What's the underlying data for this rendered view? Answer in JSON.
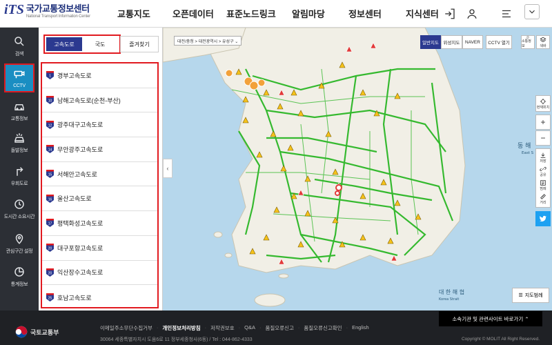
{
  "header": {
    "logo_mark": "iTS",
    "logo_title": "국가교통정보센터",
    "logo_sub": "National Transport Information Center",
    "nav": [
      "교통지도",
      "오픈데이터",
      "표준노드링크",
      "알림마당",
      "정보센터",
      "지식센터"
    ],
    "icons": [
      "login-icon",
      "user-icon",
      "menu-icon",
      "chevron-down-icon"
    ]
  },
  "sidebar": {
    "items": [
      {
        "label": "검색",
        "icon": "search-icon"
      },
      {
        "label": "CCTV",
        "icon": "cctv-icon",
        "active": true
      },
      {
        "label": "교통정보",
        "icon": "car-icon"
      },
      {
        "label": "돌발정보",
        "icon": "accident-icon"
      },
      {
        "label": "우회도로",
        "icon": "detour-icon"
      },
      {
        "label": "도시간 소요시간",
        "icon": "clock-icon"
      },
      {
        "label": "관심구간 설정",
        "icon": "pin-icon"
      },
      {
        "label": "통계정보",
        "icon": "chart-icon"
      }
    ]
  },
  "panel": {
    "tabs": [
      "고속도로",
      "국도"
    ],
    "active_tab": "고속도로",
    "favorite_label": "즐겨찾기",
    "roads": [
      {
        "num": "1",
        "name": "경부고속도로"
      },
      {
        "num": "10",
        "name": "남해고속도로(순천-부산)"
      },
      {
        "num": "12",
        "name": "광주대구고속도로"
      },
      {
        "num": "14",
        "name": "무안광주고속도로"
      },
      {
        "num": "15",
        "name": "서해안고속도로"
      },
      {
        "num": "16",
        "name": "울산고속도로"
      },
      {
        "num": "17",
        "name": "평택화성고속도로"
      },
      {
        "num": "20",
        "name": "대구포항고속도로"
      },
      {
        "num": "20",
        "name": "익산장수고속도로"
      },
      {
        "num": "25",
        "name": "호남고속도로"
      }
    ]
  },
  "map": {
    "breadcrumb": "대전/충청 > 대전광역시 > 유성구 ⌄",
    "map_types": [
      "일반지도",
      "위성지도",
      "NAVER",
      "CCTV 열기"
    ],
    "active_map_type": "일반지도",
    "controls": [
      "소통정보",
      "색바",
      "현재위치",
      "확대",
      "축소",
      "저장",
      "공유",
      "범례",
      "거리"
    ],
    "sea_east": "동 해",
    "sea_east_en": "East S",
    "sea_south": "대 한 해 협",
    "sea_south_en": "Korea Strait",
    "legend_button": "지도범례",
    "water_color": "#b6d7ec",
    "land_color": "#f1efe6",
    "road_color": "#35b92f"
  },
  "footer": {
    "ministry": "국토교통부",
    "links": [
      "이메일주소무단수집거부",
      "개인정보처리방침",
      "저작권보호",
      "Q&A",
      "품질오류신고",
      "품질오류신고확인",
      "English"
    ],
    "bold_link": "개인정보처리방침",
    "address": "30064 세종특별자치시 도움6로 11 정부세종청사(6동) / Tel : 044-862-4333",
    "related_sites": "소속기관 및 관련사이트 바로가기 ⌃",
    "copyright": "Copyright © MOLIT All Right Reserved."
  }
}
